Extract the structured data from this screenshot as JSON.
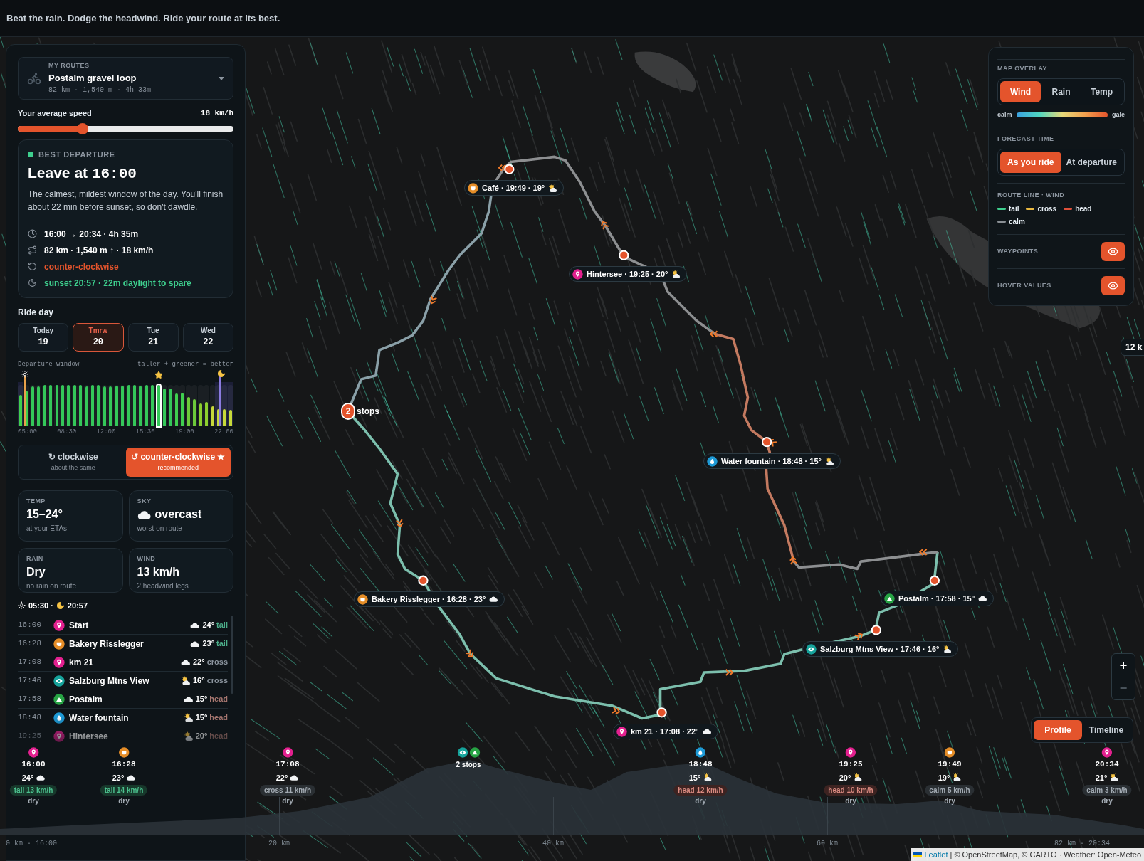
{
  "header": {
    "tagline": "Beat the rain. Dodge the headwind. Ride your route at its best."
  },
  "route_picker": {
    "label": "MY ROUTES",
    "name": "Postalm gravel loop",
    "stats": "82 km · 1,540 m · 4h 33m"
  },
  "speed": {
    "label": "Your average speed",
    "reading": "18 km/h",
    "level": 0.3
  },
  "best_departure": {
    "label": "BEST DEPARTURE",
    "title_prefix": "Leave at",
    "title_time": "16:00",
    "description": "The calmest, mildest window of the day. You'll finish about 22 min before sunset, so don't dawdle.",
    "facts": [
      {
        "kind": "time",
        "text": "16:00 → 20:34 · 4h 35m"
      },
      {
        "kind": "distance",
        "text": "82 km · 1,540 m ↑ · 18 km/h"
      },
      {
        "kind": "direction",
        "text": "counter-clockwise"
      },
      {
        "kind": "sunset",
        "text": "sunset 20:57 · 22m daylight to spare"
      }
    ]
  },
  "ride_day": {
    "label": "Ride day",
    "days": [
      {
        "name": "Today",
        "date": "19",
        "selected": false
      },
      {
        "name": "Tmrw",
        "date": "20",
        "selected": true
      },
      {
        "name": "Tue",
        "date": "21",
        "selected": false
      },
      {
        "name": "Wed",
        "date": "22",
        "selected": false
      }
    ]
  },
  "departure_window": {
    "label": "Departure window",
    "hint": "taller + greener = better",
    "ticks": [
      "05:00",
      "08:30",
      "12:00",
      "15:30",
      "19:00",
      "22:00"
    ],
    "bars": [
      {
        "level": 0.76,
        "selected": false
      },
      {
        "level": 0.87,
        "selected": false
      },
      {
        "level": 0.96,
        "selected": false
      },
      {
        "level": 0.96,
        "selected": false
      },
      {
        "level": 1,
        "selected": false
      },
      {
        "level": 1,
        "selected": false
      },
      {
        "level": 1,
        "selected": false
      },
      {
        "level": 1,
        "selected": false
      },
      {
        "level": 1,
        "selected": false
      },
      {
        "level": 1,
        "selected": false
      },
      {
        "level": 1,
        "selected": false
      },
      {
        "level": 0.96,
        "selected": false
      },
      {
        "level": 1,
        "selected": false
      },
      {
        "level": 1,
        "selected": false
      },
      {
        "level": 0.96,
        "selected": false
      },
      {
        "level": 0.96,
        "selected": false
      },
      {
        "level": 0.99,
        "selected": false
      },
      {
        "level": 0.99,
        "selected": false
      },
      {
        "level": 1,
        "selected": false
      },
      {
        "level": 1,
        "selected": false
      },
      {
        "level": 0.99,
        "selected": false
      },
      {
        "level": 1,
        "selected": false
      },
      {
        "level": 1,
        "selected": false
      },
      {
        "level": 1,
        "selected": true
      },
      {
        "level": 0.92,
        "selected": false
      },
      {
        "level": 0.92,
        "selected": false
      },
      {
        "level": 0.8,
        "selected": false
      },
      {
        "level": 0.81,
        "selected": false
      },
      {
        "level": 0.7,
        "selected": false
      },
      {
        "level": 0.65,
        "selected": false
      },
      {
        "level": 0.55,
        "selected": false
      },
      {
        "level": 0.58,
        "selected": false
      },
      {
        "level": 0.49,
        "selected": false
      },
      {
        "level": 0.41,
        "selected": false
      },
      {
        "level": 0.41,
        "selected": false
      },
      {
        "level": 0.39,
        "selected": false
      }
    ]
  },
  "direction": [
    {
      "label": "↻ clockwise",
      "sub": "about the same",
      "selected": false
    },
    {
      "label": "↺ counter-clockwise ★",
      "sub": "recommended",
      "selected": true
    }
  ],
  "stats": [
    {
      "label": "TEMP",
      "value": "15–24°",
      "sub": "at your ETAs"
    },
    {
      "label": "SKY",
      "value": "overcast",
      "sky": {
        "kind": "cloud"
      },
      "sub": "worst on route"
    },
    {
      "label": "RAIN",
      "value": "Dry",
      "sub": "no rain on route"
    },
    {
      "label": "WIND",
      "value": "13 km/h",
      "sub": "2 headwind legs"
    }
  ],
  "sun": {
    "sunrise": "05:30 ·",
    "sunset": "20:57"
  },
  "itinerary": [
    {
      "time": "16:00",
      "kind": "pin",
      "name": "Start",
      "sky": {
        "kind": "cloud"
      },
      "temp": "24°",
      "wind": "tail"
    },
    {
      "time": "16:28",
      "kind": "cafe",
      "name": "Bakery Risslegger",
      "sky": {
        "kind": "cloud"
      },
      "temp": "23°",
      "wind": "tail"
    },
    {
      "time": "17:08",
      "kind": "pin",
      "name": "km 21",
      "sky": {
        "kind": "cloud"
      },
      "temp": "22°",
      "wind": "cross"
    },
    {
      "time": "17:46",
      "kind": "view",
      "name": "Salzburg Mtns View",
      "sky": {
        "kind": "partly"
      },
      "temp": "16°",
      "wind": "cross"
    },
    {
      "time": "17:58",
      "kind": "peak",
      "name": "Postalm",
      "sky": {
        "kind": "cloud"
      },
      "temp": "15°",
      "wind": "head"
    },
    {
      "time": "18:48",
      "kind": "water",
      "name": "Water fountain",
      "sky": {
        "kind": "partly"
      },
      "temp": "15°",
      "wind": "head"
    },
    {
      "time": "19:25",
      "kind": "pin",
      "name": "Hintersee",
      "sky": {
        "kind": "partly"
      },
      "temp": "20°",
      "wind": "head"
    }
  ],
  "map": {
    "waypoints": [
      {
        "kind": "cafe",
        "text": "Café · 19:49 · 19°",
        "sky": {
          "kind": "partly"
        }
      },
      {
        "kind": "pin",
        "text": "Hintersee · 19:25 · 20°",
        "sky": {
          "kind": "partly"
        }
      },
      {
        "kind": "water",
        "text": "Water fountain · 18:48 · 15°",
        "sky": {
          "kind": "partly"
        }
      },
      {
        "kind": "peak",
        "text": "Postalm · 17:58 · 15°",
        "sky": {
          "kind": "cloud"
        }
      },
      {
        "kind": "view",
        "text": "Salzburg Mtns View · 17:46 · 16°",
        "sky": {
          "kind": "partly"
        }
      },
      {
        "kind": "pin",
        "text": "km 21 · 17:08 · 22°",
        "sky": {
          "kind": "cloud"
        }
      },
      {
        "kind": "cafe",
        "text": "Bakery Risslegger · 16:28 · 23°",
        "sky": {
          "kind": "cloud"
        }
      }
    ],
    "cluster": {
      "count": "2",
      "text": "stops"
    },
    "edge_label": "12 k"
  },
  "overlay": {
    "overlay_label": "MAP OVERLAY",
    "overlay_tabs": [
      {
        "label": "Wind",
        "selected": true
      },
      {
        "label": "Rain",
        "selected": false
      },
      {
        "label": "Temp",
        "selected": false
      }
    ],
    "scale": {
      "low": "calm",
      "high": "gale"
    },
    "forecast_label": "FORECAST TIME",
    "forecast_tabs": [
      {
        "label": "As you ride",
        "selected": true
      },
      {
        "label": "At departure",
        "selected": false
      }
    ],
    "legend_label": "ROUTE LINE · WIND",
    "legend": [
      {
        "label": "tail",
        "color": "#3ecf8e"
      },
      {
        "label": "cross",
        "color": "#e8b840"
      },
      {
        "label": "head",
        "color": "#e0503a"
      },
      {
        "label": "calm",
        "color": "#8a8f94"
      }
    ],
    "toggles": [
      {
        "label": "WAYPOINTS",
        "on": true
      },
      {
        "label": "HOVER VALUES",
        "on": true
      }
    ]
  },
  "zoom": [
    {
      "symbol": "+",
      "disabled": false
    },
    {
      "symbol": "−",
      "disabled": true
    }
  ],
  "view_tabs": [
    {
      "label": "Profile",
      "selected": true
    },
    {
      "label": "Timeline",
      "selected": false
    }
  ],
  "profile": {
    "stops": [
      {
        "kind": "stop",
        "icons": [
          {
            "kind": "pin"
          }
        ],
        "time": "16:00",
        "temp": "24°",
        "sky": {
          "kind": "cloud"
        },
        "wind": "tail",
        "wind_speed": "13 km/h",
        "rain": "dry"
      },
      {
        "kind": "stop",
        "icons": [
          {
            "kind": "cafe"
          }
        ],
        "time": "16:28",
        "temp": "23°",
        "sky": {
          "kind": "cloud"
        },
        "wind": "tail",
        "wind_speed": "14 km/h",
        "rain": "dry"
      },
      {
        "kind": "stop",
        "icons": [
          {
            "kind": "pin"
          }
        ],
        "time": "17:08",
        "temp": "22°",
        "sky": {
          "kind": "cloud"
        },
        "wind": "cross",
        "wind_speed": "11 km/h",
        "rain": "dry"
      },
      {
        "kind": "cluster",
        "icons": [
          {
            "kind": "view"
          },
          {
            "kind": "peak"
          }
        ],
        "label": "2 stops"
      },
      {
        "kind": "stop",
        "icons": [
          {
            "kind": "water"
          }
        ],
        "time": "18:48",
        "temp": "15°",
        "sky": {
          "kind": "partly"
        },
        "wind": "head",
        "wind_speed": "12 km/h",
        "rain": "dry"
      },
      {
        "kind": "stop",
        "icons": [
          {
            "kind": "pin"
          }
        ],
        "time": "19:25",
        "temp": "20°",
        "sky": {
          "kind": "partly"
        },
        "wind": "head",
        "wind_speed": "10 km/h",
        "rain": "dry"
      },
      {
        "kind": "stop",
        "icons": [
          {
            "kind": "cafe"
          }
        ],
        "time": "19:49",
        "temp": "19°",
        "sky": {
          "kind": "partly"
        },
        "wind": "calm",
        "wind_speed": "5 km/h",
        "rain": "dry"
      },
      {
        "kind": "stop",
        "icons": [
          {
            "kind": "pin"
          }
        ],
        "time": "20:34",
        "temp": "21°",
        "sky": {
          "kind": "partly"
        },
        "wind": "calm",
        "wind_speed": "3 km/h",
        "rain": "dry"
      }
    ],
    "axis": [
      "0 km · 16:00",
      "20 km",
      "40 km",
      "60 km",
      "82 km · 20:34"
    ]
  },
  "attribution": {
    "link": "Leaflet",
    "text": "| © OpenStreetMap, © CARTO · Weather: Open-Meteo"
  }
}
